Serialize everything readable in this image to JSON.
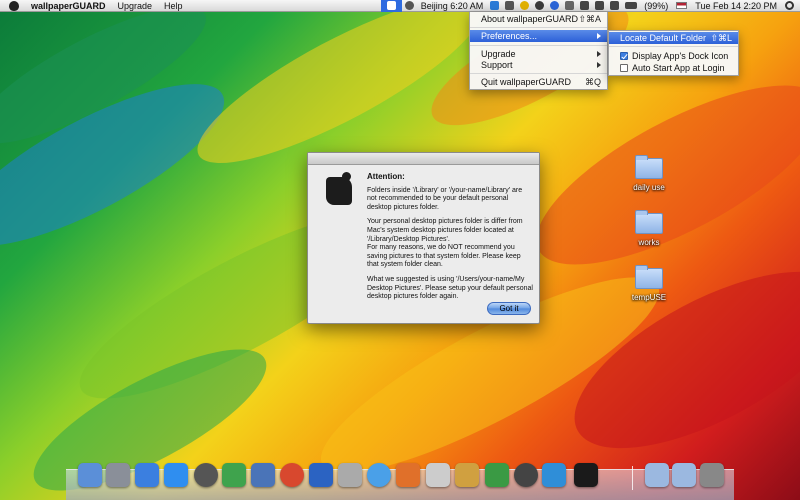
{
  "menubar": {
    "app_name": "wallpaperGUARD",
    "menus": [
      "Upgrade",
      "Help"
    ],
    "location_time": "Beijing 6:20 AM",
    "battery": "(99%)",
    "clock": "Tue Feb 14  2:20 PM"
  },
  "status_menu": {
    "items": [
      {
        "label": "About wallpaperGUARD",
        "shortcut": "⇧⌘A"
      },
      {
        "label": "Preferences...",
        "shortcut": ""
      },
      {
        "label": "Upgrade",
        "shortcut": ""
      },
      {
        "label": "Support",
        "shortcut": ""
      },
      {
        "label": "Quit wallpaperGUARD",
        "shortcut": "⌘Q"
      }
    ]
  },
  "preferences_submenu": {
    "items": [
      {
        "label": "Locate Default Folder",
        "shortcut": "⇧⌘L"
      },
      {
        "label": "Display App's Dock Icon",
        "checked": true
      },
      {
        "label": "Auto Start App at Login",
        "checked": false
      }
    ]
  },
  "dialog": {
    "heading": "Attention:",
    "paragraph1": "Folders inside '/Library' or '/your-name/Library' are not recommended to be your default personal desktop pictures folder.",
    "paragraph2": "Your personal desktop pictures folder is differ from Mac's system desktop pictures folder located at '/Library/Desktop Pictures'.\nFor many reasons, we do NOT recommend you saving pictures to that system folder. Please keep that system folder clean.",
    "paragraph3": "What we suggested is using '/Users/your-name/My Desktop Pictures'. Please setup your default personal desktop pictures folder again.",
    "button": "Got it"
  },
  "desktop": {
    "folders": [
      "daily use",
      "works",
      "tempUSE"
    ]
  },
  "dock": {
    "apps": [
      "finder-icon",
      "launchpad-icon",
      "itunes-icon",
      "app-store-icon",
      "dashboard-icon",
      "messenger-icon",
      "preview-icon",
      "chrome-icon",
      "network-icon",
      "screenshot-icon",
      "safari-icon",
      "firefox-icon",
      "textedit-icon",
      "pages-icon",
      "numbers-icon",
      "timemachine-icon",
      "feed-icon",
      "wallpaperguard-icon",
      "applications-folder-icon",
      "downloads-folder-icon",
      "trash-icon"
    ]
  }
}
